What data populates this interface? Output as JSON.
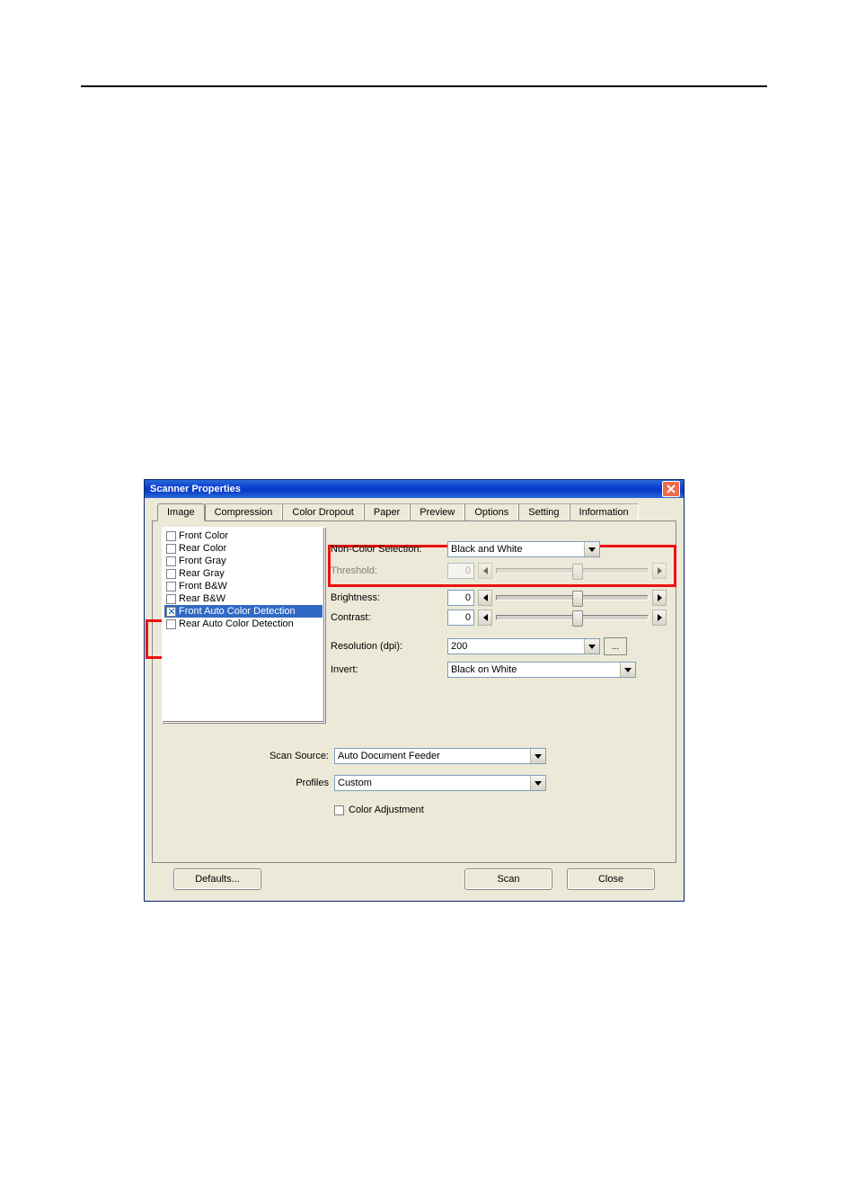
{
  "dialog": {
    "title": "Scanner Properties"
  },
  "tabs": {
    "items": [
      "Image",
      "Compression",
      "Color Dropout",
      "Paper",
      "Preview",
      "Options",
      "Setting",
      "Information"
    ],
    "active_index": 0
  },
  "image_selection": {
    "items": [
      {
        "label": "Front Color",
        "checked": false,
        "selected": false
      },
      {
        "label": "Rear Color",
        "checked": false,
        "selected": false
      },
      {
        "label": "Front Gray",
        "checked": false,
        "selected": false
      },
      {
        "label": "Rear Gray",
        "checked": false,
        "selected": false
      },
      {
        "label": "Front B&W",
        "checked": false,
        "selected": false
      },
      {
        "label": "Rear B&W",
        "checked": false,
        "selected": false
      },
      {
        "label": "Front Auto Color Detection",
        "checked": true,
        "selected": true
      },
      {
        "label": "Rear Auto Color Detection",
        "checked": false,
        "selected": false
      }
    ]
  },
  "controls": {
    "non_color_selection": {
      "label": "Non-Color Selection:",
      "value": "Black and White"
    },
    "threshold": {
      "label": "Threshold:",
      "value": "0",
      "disabled": true
    },
    "brightness": {
      "label": "Brightness:",
      "value": "0"
    },
    "contrast": {
      "label": "Contrast:",
      "value": "0"
    },
    "resolution": {
      "label": "Resolution (dpi):",
      "value": "200",
      "more": "..."
    },
    "invert": {
      "label": "Invert:",
      "value": "Black on White"
    }
  },
  "lower": {
    "scan_source": {
      "label": "Scan Source:",
      "value": "Auto Document Feeder"
    },
    "profiles": {
      "label": "Profiles",
      "value": "Custom"
    },
    "color_adjustment": {
      "label": "Color Adjustment",
      "checked": false
    }
  },
  "buttons": {
    "defaults": "Defaults...",
    "scan": "Scan",
    "close": "Close"
  }
}
